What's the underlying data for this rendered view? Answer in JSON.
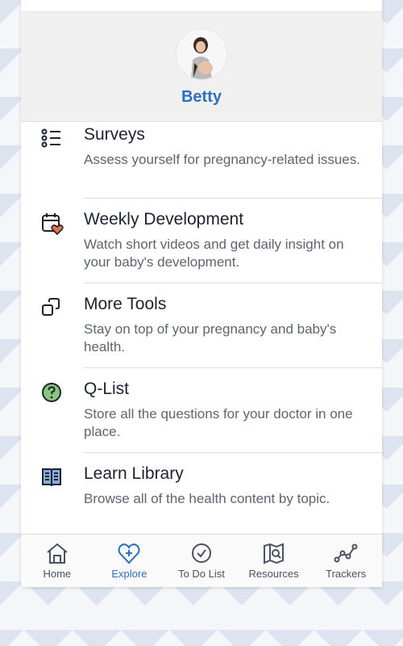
{
  "profile": {
    "name": "Betty"
  },
  "menu": [
    {
      "title": "Surveys",
      "description": "Assess yourself for pregnancy-related issues.",
      "icon": "list-icon"
    },
    {
      "title": "Weekly Development",
      "description": "Watch short videos and get daily insight on your baby's development.",
      "icon": "calendar-heart-icon"
    },
    {
      "title": "More Tools",
      "description": "Stay on top of your pregnancy and baby's health.",
      "icon": "tools-icon"
    },
    {
      "title": "Q-List",
      "description": "Store all the questions for your doctor in one place.",
      "icon": "question-icon"
    },
    {
      "title": "Learn Library",
      "description": "Browse all of the health content by topic.",
      "icon": "book-icon"
    }
  ],
  "nav": [
    {
      "label": "Home",
      "icon": "home-icon"
    },
    {
      "label": "Explore",
      "icon": "heart-plus-icon",
      "active": true
    },
    {
      "label": "To Do List",
      "icon": "check-circle-icon"
    },
    {
      "label": "Resources",
      "icon": "map-search-icon"
    },
    {
      "label": "Trackers",
      "icon": "trend-icon"
    }
  ],
  "colors": {
    "accent": "#2f6fba",
    "heart": "#e8734a",
    "question": "#8bc47a",
    "book": "#8aa8d8"
  }
}
